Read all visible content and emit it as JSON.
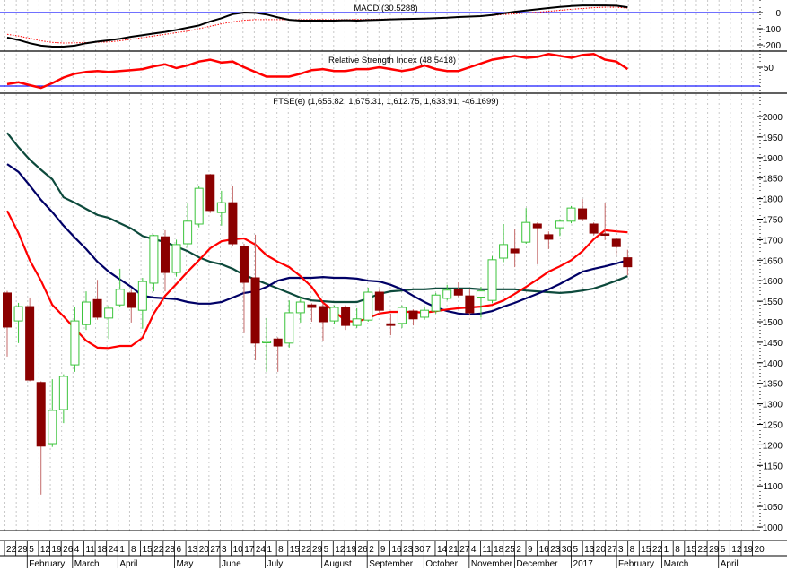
{
  "chart_data": {
    "type": "candlestick",
    "title": "FTSE(e) (1,655.82, 1,675.31, 1,612.75, 1,633.91, -46.1699)",
    "colors": {
      "down": "#8b0000",
      "up": "#3cc43c",
      "ma_short": "#ff0000",
      "ma_mid": "#000066",
      "ma_long": "#0d4a3c",
      "macd": "#000000",
      "signal": "#ff0000",
      "rsi": "#ff0000",
      "ref_line": "#1a1aff"
    },
    "macd": {
      "label": "MACD (30.5288)",
      "ticks": [
        "0",
        "-100",
        "-200"
      ],
      "tick_values": [
        0,
        -100,
        -200
      ],
      "macd": [
        -155,
        -170,
        -190,
        -205,
        -211,
        -211,
        -205,
        -190,
        -180,
        -172,
        -162,
        -150,
        -140,
        -130,
        -120,
        -108,
        -94,
        -80,
        -55,
        -35,
        -10,
        0,
        -2,
        -12,
        -30,
        -45,
        -50,
        -50,
        -50,
        -50,
        -48,
        -50,
        -47,
        -45,
        -42,
        -40,
        -39,
        -37,
        -35,
        -32,
        -28,
        -25,
        -22,
        -15,
        -5,
        5,
        12,
        20,
        28,
        35,
        40,
        44,
        44,
        44,
        42,
        33
      ],
      "signal": [
        -135,
        -145,
        -160,
        -175,
        -185,
        -189,
        -188,
        -186,
        -184,
        -182,
        -175,
        -165,
        -155,
        -145,
        -135,
        -125,
        -115,
        -100,
        -85,
        -70,
        -58,
        -48,
        -44,
        -44,
        -44,
        -44,
        -44,
        -44,
        -44,
        -44,
        -44,
        -43,
        -42,
        -41,
        -40,
        -38,
        -37,
        -35,
        -33,
        -30,
        -28,
        -26,
        -22,
        -18,
        -12,
        -8,
        -3,
        2,
        8,
        14,
        20,
        25,
        30,
        33,
        33,
        28
      ]
    },
    "rsi": {
      "label": "Relative Strength Index (48.5418)",
      "ticks": [
        "50"
      ],
      "tick_values": [
        50
      ],
      "reference_level": 30,
      "values": [
        32,
        34,
        31,
        28,
        33,
        39,
        43,
        45,
        46,
        45,
        46,
        47,
        48,
        51,
        53,
        49,
        52,
        56,
        58,
        55,
        56,
        50,
        45,
        40,
        40,
        40,
        43,
        47,
        48,
        46,
        46,
        48,
        48,
        50,
        48,
        46,
        48,
        52,
        48,
        46,
        46,
        50,
        54,
        58,
        60,
        62,
        60,
        61,
        64,
        62,
        60,
        63,
        64,
        58,
        56,
        48
      ]
    },
    "price": {
      "ylim": [
        1000,
        2000
      ],
      "yticks": [
        "2000",
        "1950",
        "1900",
        "1850",
        "1800",
        "1750",
        "1700",
        "1650",
        "1600",
        "1550",
        "1500",
        "1450",
        "1400",
        "1350",
        "1300",
        "1250",
        "1200",
        "1150",
        "1100",
        "1050",
        "1000"
      ],
      "candles_ohlc": [
        [
          1570,
          1575,
          1415,
          1487
        ],
        [
          1502,
          1546,
          1448,
          1537
        ],
        [
          1537,
          1559,
          1355,
          1358
        ],
        [
          1352,
          1355,
          1079,
          1197
        ],
        [
          1203,
          1360,
          1195,
          1284
        ],
        [
          1286,
          1372,
          1253,
          1367
        ],
        [
          1395,
          1535,
          1378,
          1502
        ],
        [
          1493,
          1574,
          1480,
          1548
        ],
        [
          1554,
          1602,
          1505,
          1511
        ],
        [
          1509,
          1540,
          1458,
          1533
        ],
        [
          1541,
          1629,
          1535,
          1579
        ],
        [
          1570,
          1578,
          1498,
          1535
        ],
        [
          1528,
          1607,
          1483,
          1598
        ],
        [
          1594,
          1712,
          1574,
          1710
        ],
        [
          1707,
          1723,
          1574,
          1620
        ],
        [
          1620,
          1700,
          1610,
          1688
        ],
        [
          1690,
          1788,
          1680,
          1745
        ],
        [
          1738,
          1830,
          1730,
          1825
        ],
        [
          1858,
          1860,
          1765,
          1771
        ],
        [
          1766,
          1819,
          1734,
          1790
        ],
        [
          1790,
          1830,
          1685,
          1690
        ],
        [
          1683,
          1690,
          1472,
          1596
        ],
        [
          1607,
          1712,
          1406,
          1448
        ],
        [
          1450,
          1509,
          1378,
          1452
        ],
        [
          1458,
          1462,
          1378,
          1441
        ],
        [
          1448,
          1552,
          1437,
          1522
        ],
        [
          1522,
          1560,
          1498,
          1548
        ],
        [
          1541,
          1545,
          1500,
          1535
        ],
        [
          1537,
          1545,
          1454,
          1500
        ],
        [
          1502,
          1540,
          1495,
          1535
        ],
        [
          1535,
          1540,
          1480,
          1491
        ],
        [
          1491,
          1533,
          1485,
          1507
        ],
        [
          1504,
          1583,
          1500,
          1572
        ],
        [
          1572,
          1578,
          1520,
          1528
        ],
        [
          1495,
          1520,
          1467,
          1491
        ],
        [
          1496,
          1540,
          1485,
          1535
        ],
        [
          1526,
          1530,
          1491,
          1507
        ],
        [
          1511,
          1535,
          1505,
          1528
        ],
        [
          1526,
          1570,
          1520,
          1565
        ],
        [
          1557,
          1590,
          1552,
          1577
        ],
        [
          1579,
          1596,
          1560,
          1565
        ],
        [
          1563,
          1581,
          1515,
          1522
        ],
        [
          1560,
          1585,
          1510,
          1575
        ],
        [
          1552,
          1660,
          1545,
          1651
        ],
        [
          1655,
          1738,
          1645,
          1688
        ],
        [
          1677,
          1725,
          1633,
          1668
        ],
        [
          1694,
          1777,
          1690,
          1742
        ],
        [
          1738,
          1742,
          1640,
          1729
        ],
        [
          1712,
          1720,
          1677,
          1701
        ],
        [
          1729,
          1750,
          1709,
          1745
        ],
        [
          1745,
          1782,
          1740,
          1777
        ],
        [
          1775,
          1799,
          1745,
          1751
        ],
        [
          1738,
          1742,
          1710,
          1716
        ],
        [
          1714,
          1790,
          1699,
          1713
        ],
        [
          1701,
          1705,
          1663,
          1683
        ],
        [
          1655.82,
          1675.31,
          1612.75,
          1633.91
        ]
      ],
      "ma_short": [
        1770,
        1716,
        1650,
        1600,
        1541,
        1513,
        1483,
        1454,
        1437,
        1436,
        1441,
        1441,
        1461,
        1520,
        1563,
        1592,
        1622,
        1650,
        1679,
        1696,
        1701,
        1703,
        1688,
        1662,
        1646,
        1633,
        1611,
        1585,
        1546,
        1526,
        1502,
        1500,
        1509,
        1520,
        1524,
        1524,
        1524,
        1522,
        1526,
        1530,
        1533,
        1535,
        1537,
        1541,
        1552,
        1568,
        1585,
        1603,
        1622,
        1635,
        1650,
        1672,
        1701,
        1723,
        1720,
        1718
      ],
      "ma_mid": [
        1884,
        1865,
        1832,
        1797,
        1767,
        1734,
        1705,
        1677,
        1646,
        1622,
        1603,
        1585,
        1563,
        1559,
        1557,
        1555,
        1548,
        1544,
        1544,
        1548,
        1559,
        1570,
        1574,
        1585,
        1600,
        1607,
        1607,
        1607,
        1609,
        1607,
        1607,
        1605,
        1600,
        1598,
        1590,
        1579,
        1563,
        1548,
        1535,
        1526,
        1520,
        1518,
        1520,
        1526,
        1537,
        1546,
        1557,
        1568,
        1579,
        1592,
        1607,
        1622,
        1629,
        1635,
        1642,
        1650
      ],
      "ma_long": [
        1960,
        1925,
        1895,
        1870,
        1847,
        1803,
        1790,
        1775,
        1760,
        1753,
        1740,
        1727,
        1709,
        1701,
        1694,
        1683,
        1672,
        1657,
        1646,
        1640,
        1629,
        1614,
        1603,
        1592,
        1581,
        1570,
        1559,
        1552,
        1550,
        1548,
        1548,
        1548,
        1557,
        1568,
        1574,
        1576,
        1579,
        1579,
        1581,
        1581,
        1581,
        1581,
        1579,
        1579,
        1579,
        1579,
        1576,
        1574,
        1572,
        1570,
        1572,
        1576,
        1581,
        1590,
        1600,
        1611
      ]
    },
    "xaxis": {
      "dates": [
        "5",
        "22",
        "29",
        "5",
        "12",
        "19",
        "26",
        "4",
        "11",
        "18",
        "24",
        "1",
        "8",
        "15",
        "22",
        "28",
        "6",
        "13",
        "20",
        "27",
        "3",
        "10",
        "17",
        "24",
        "1",
        "8",
        "15",
        "22",
        "29",
        "5",
        "12",
        "19",
        "26",
        "2",
        "9",
        "16",
        "23",
        "30",
        "7",
        "14",
        "21",
        "27",
        "4",
        "11",
        "18",
        "25",
        "2",
        "9",
        "16",
        "23",
        "30",
        "5",
        "13",
        "20",
        "27",
        "3",
        "8",
        "15",
        "22",
        "1",
        "8",
        "15",
        "22",
        "29",
        "5",
        "12",
        "19",
        "20"
      ],
      "months": [
        {
          "label": "February",
          "date_index": 3
        },
        {
          "label": "March",
          "date_index": 7
        },
        {
          "label": "April",
          "date_index": 11
        },
        {
          "label": "May",
          "date_index": 16
        },
        {
          "label": "June",
          "date_index": 20
        },
        {
          "label": "July",
          "date_index": 24
        },
        {
          "label": "August",
          "date_index": 29
        },
        {
          "label": "September",
          "date_index": 33
        },
        {
          "label": "October",
          "date_index": 38
        },
        {
          "label": "November",
          "date_index": 42
        },
        {
          "label": "December",
          "date_index": 46
        },
        {
          "label": "2017",
          "date_index": 51
        },
        {
          "label": "February",
          "date_index": 55
        },
        {
          "label": "March",
          "date_index": 59
        },
        {
          "label": "April",
          "date_index": 64
        }
      ]
    }
  }
}
